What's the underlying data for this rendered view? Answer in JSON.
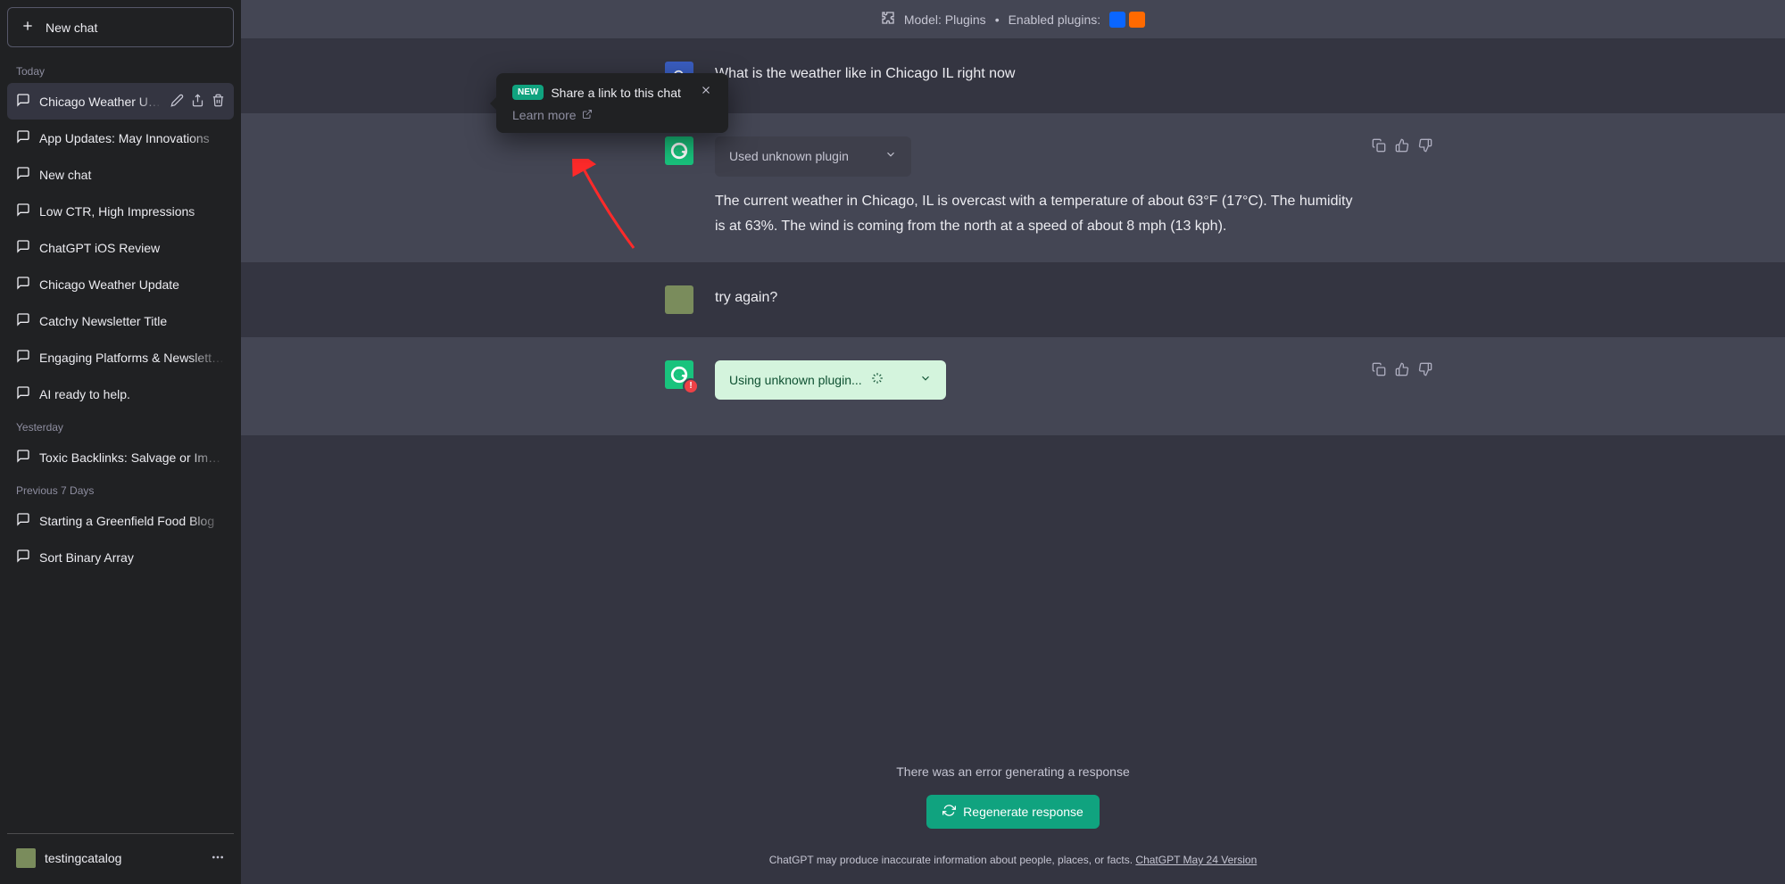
{
  "sidebar": {
    "new_chat_label": "New chat",
    "sections": [
      {
        "label": "Today",
        "items": [
          {
            "title": "Chicago Weather Update",
            "active": true
          },
          {
            "title": "App Updates: May Innovations"
          },
          {
            "title": "New chat"
          },
          {
            "title": "Low CTR, High Impressions"
          },
          {
            "title": "ChatGPT iOS Review"
          },
          {
            "title": "Chicago Weather Update"
          },
          {
            "title": "Catchy Newsletter Title"
          },
          {
            "title": "Engaging Platforms & Newsletters"
          },
          {
            "title": "AI ready to help."
          }
        ]
      },
      {
        "label": "Yesterday",
        "items": [
          {
            "title": "Toxic Backlinks: Salvage or Import"
          }
        ]
      },
      {
        "label": "Previous 7 Days",
        "items": [
          {
            "title": "Starting a Greenfield Food Blog"
          },
          {
            "title": "Sort Binary Array"
          }
        ]
      }
    ],
    "user_name": "testingcatalog"
  },
  "popover": {
    "badge": "NEW",
    "title": "Share a link to this chat",
    "learn_more": "Learn more"
  },
  "header": {
    "model_label": "Model: Plugins",
    "enabled_label": "Enabled plugins:"
  },
  "messages": {
    "m0_text": "What is the weather like in Chicago IL right now",
    "m1_plugin_label": "Used unknown plugin",
    "m1_text": "The current weather in Chicago, IL is overcast with a temperature of about 63°F (17°C). The humidity is at 63%. The wind is coming from the north at a speed of about 8 mph (13 kph).",
    "m2_text": "try again?",
    "m3_plugin_label": "Using unknown plugin..."
  },
  "footer": {
    "error_text": "There was an error generating a response",
    "regenerate_label": "Regenerate response",
    "disclaimer_prefix": "ChatGPT may produce inaccurate information about people, places, or facts. ",
    "version_link": "ChatGPT May 24 Version"
  }
}
